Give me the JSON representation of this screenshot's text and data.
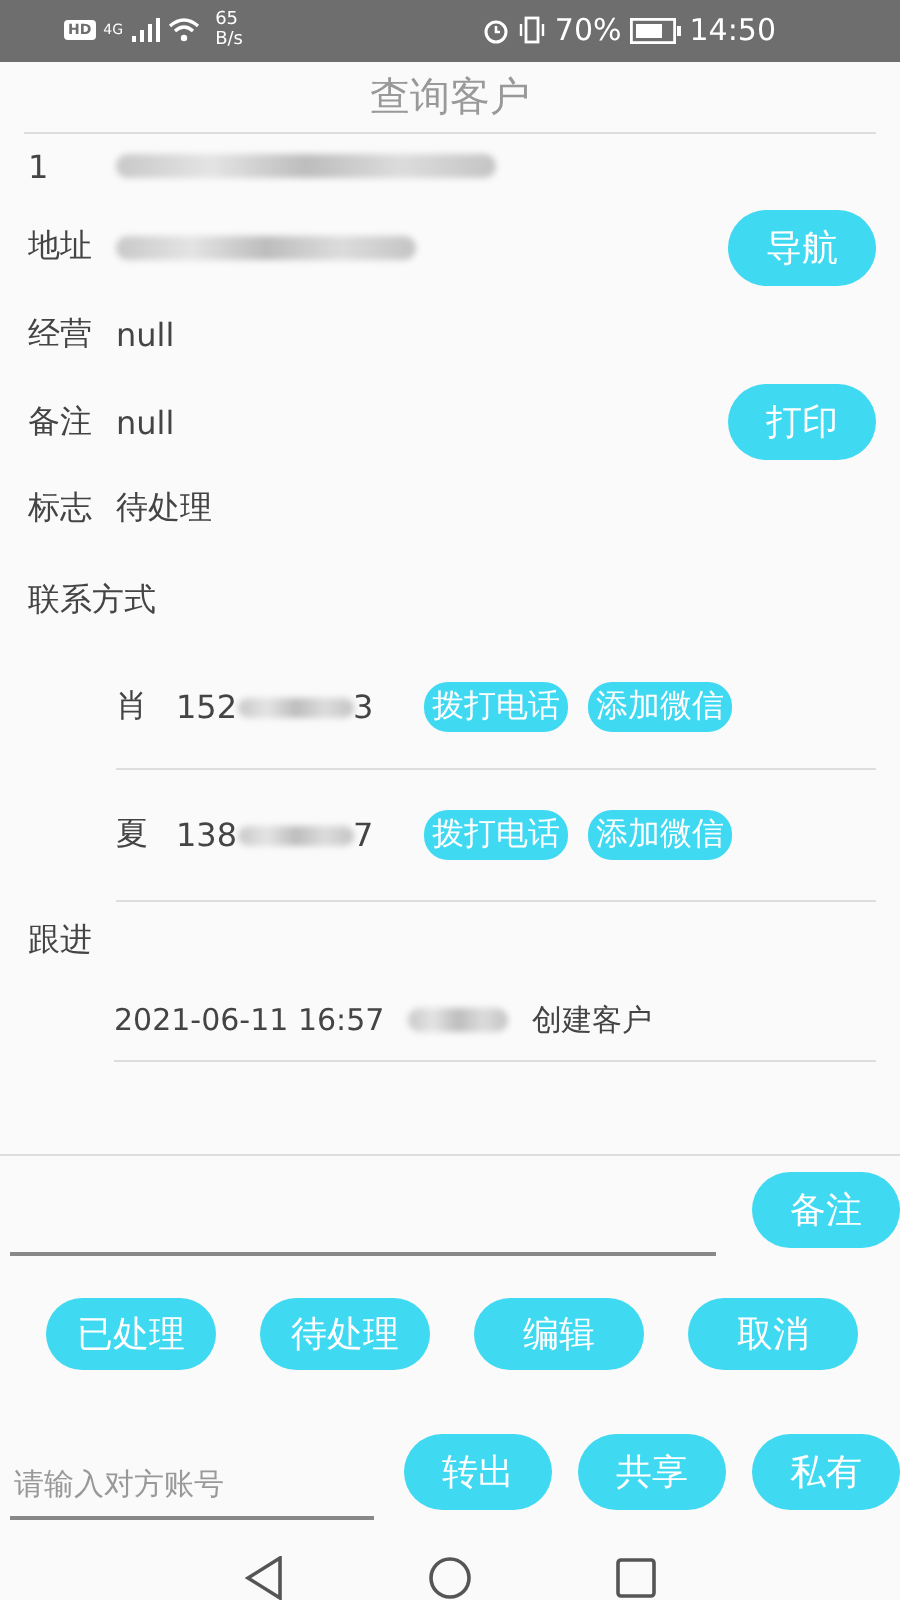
{
  "status_bar": {
    "hd": "HD",
    "network": "4G",
    "speed_value": "65",
    "speed_unit": "B/s",
    "battery": "70%",
    "time": "14:50"
  },
  "title": "查询客户",
  "customer": {
    "index": "1"
  },
  "fields": [
    {
      "label": "地址",
      "redacted": true,
      "button": "导航"
    },
    {
      "label": "经营",
      "value": "null"
    },
    {
      "label": "备注",
      "value": "null",
      "button": "打印"
    },
    {
      "label": "标志",
      "value": "待处理"
    }
  ],
  "contacts_label": "联系方式",
  "contacts": [
    {
      "surname": "肖",
      "phone_start": "152",
      "phone_end": "3",
      "call": "拨打电话",
      "wechat": "添加微信"
    },
    {
      "surname": "夏",
      "phone_start": "138",
      "phone_end": "7",
      "call": "拨打电话",
      "wechat": "添加微信"
    }
  ],
  "follow_label": "跟进",
  "follow_ups": [
    {
      "time": "2021-06-11 16:57",
      "action": "创建客户"
    }
  ],
  "note_button": "备注",
  "actions": [
    "已处理",
    "待处理",
    "编辑",
    "取消"
  ],
  "account": {
    "placeholder": "请输入对方账号"
  },
  "transfer_buttons": [
    "转出",
    "共享",
    "私有"
  ]
}
